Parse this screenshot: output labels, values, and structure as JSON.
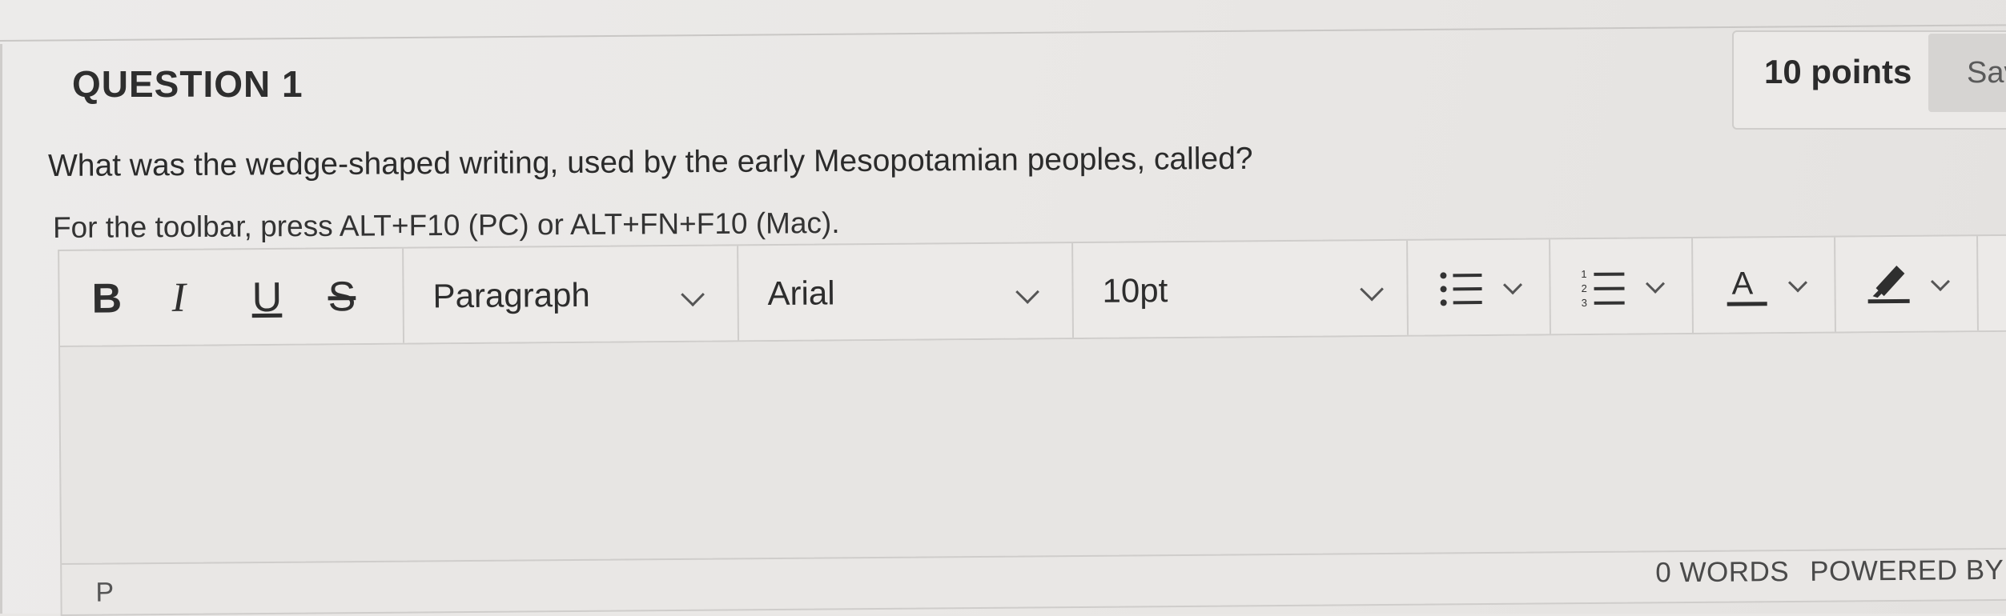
{
  "question": {
    "title": "QUESTION 1",
    "points": "10 points",
    "save_label": "Save Answer",
    "prompt": "What was the wedge-shaped writing, used by the early Mesopotamian peoples, called?",
    "toolbar_hint": "For the toolbar, press ALT+F10 (PC) or ALT+FN+F10 (Mac)."
  },
  "editor": {
    "format_buttons": {
      "bold": "B",
      "italic": "I",
      "underline": "U",
      "strikethrough": "S"
    },
    "block_format": "Paragraph",
    "font_family": "Arial",
    "font_size": "10pt",
    "icons": [
      "bullet-list-icon",
      "numbered-list-icon",
      "text-color-icon",
      "highlight-icon"
    ],
    "path": "P",
    "word_count": "0 WORDS",
    "powered_by": "POWERED BY TINY"
  }
}
